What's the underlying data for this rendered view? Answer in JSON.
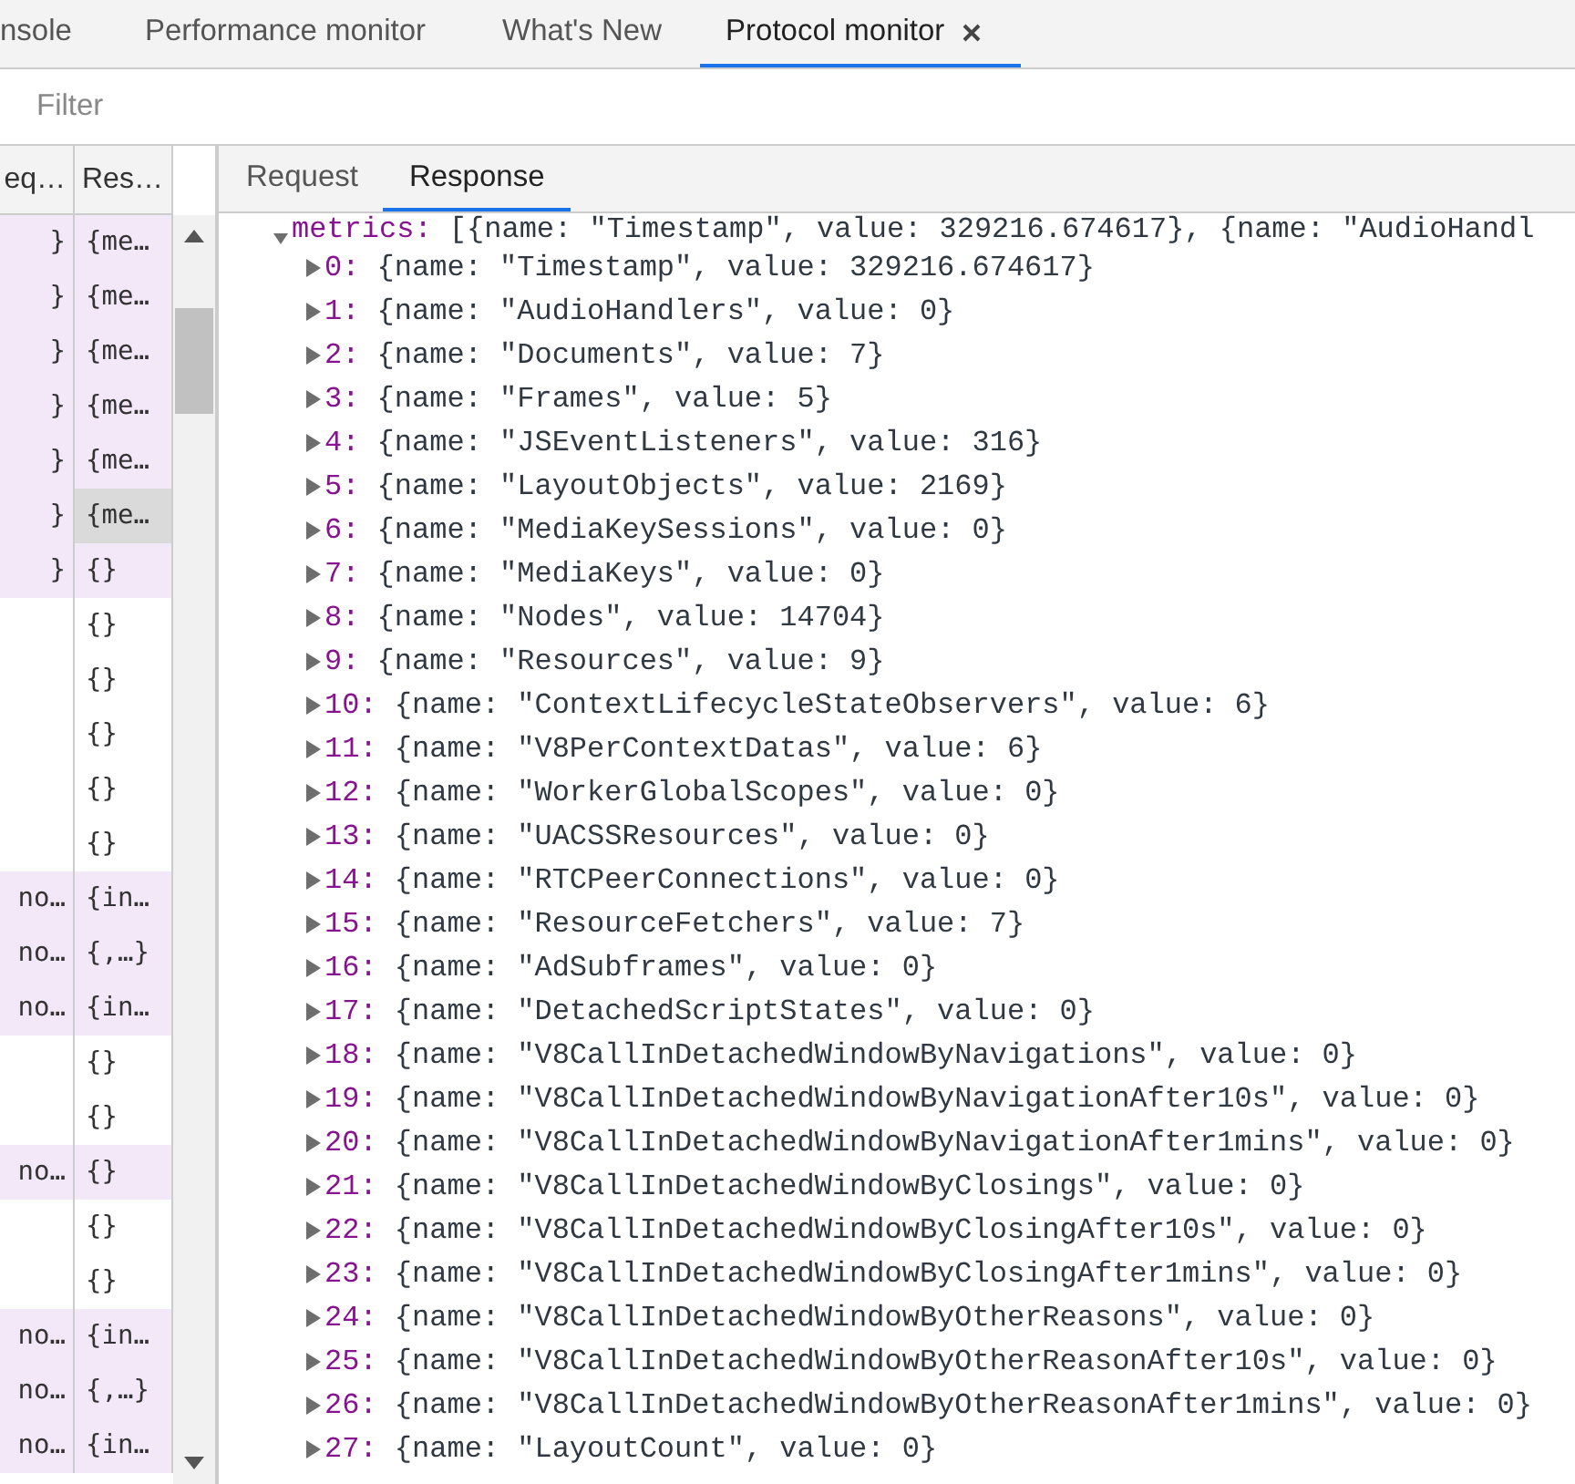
{
  "tabs": [
    {
      "label": "nsole",
      "selected": false,
      "closable": false
    },
    {
      "label": "Performance monitor",
      "selected": false,
      "closable": false
    },
    {
      "label": "What's New",
      "selected": false,
      "closable": false
    },
    {
      "label": "Protocol monitor",
      "selected": true,
      "closable": true
    }
  ],
  "filter": {
    "placeholder": "Filter"
  },
  "messages": {
    "columns": [
      "eq…",
      "Res…"
    ],
    "rows": [
      {
        "column_1": "}",
        "column_2": "{me…",
        "highlighted": true,
        "selected": false
      },
      {
        "column_1": "}",
        "column_2": "{me…",
        "highlighted": true,
        "selected": false
      },
      {
        "column_1": "}",
        "column_2": "{me…",
        "highlighted": true,
        "selected": false
      },
      {
        "column_1": "}",
        "column_2": "{me…",
        "highlighted": true,
        "selected": false
      },
      {
        "column_1": "}",
        "column_2": "{me…",
        "highlighted": true,
        "selected": false
      },
      {
        "column_1": "}",
        "column_2": "{me…",
        "highlighted": true,
        "selected": true
      },
      {
        "column_1": "}",
        "column_2": "{}",
        "highlighted": true,
        "selected": false
      },
      {
        "column_2": "{}",
        "highlighted": false,
        "selected": false
      },
      {
        "column_2": "{}",
        "highlighted": false,
        "selected": false
      },
      {
        "column_2": "{}",
        "highlighted": false,
        "selected": false
      },
      {
        "column_2": "{}",
        "highlighted": false,
        "selected": false
      },
      {
        "column_2": "{}",
        "highlighted": false,
        "selected": false
      },
      {
        "column_1": "no…",
        "column_2": "{in…",
        "highlighted": true,
        "selected": false
      },
      {
        "column_1": "no…",
        "column_2": "{,…}",
        "highlighted": true,
        "selected": false
      },
      {
        "column_1": "no…",
        "column_2": "{in…",
        "highlighted": true,
        "selected": false
      },
      {
        "column_2": "{}",
        "highlighted": false,
        "selected": false
      },
      {
        "column_2": "{}",
        "highlighted": false,
        "selected": false
      },
      {
        "column_1": "no…",
        "column_2": "{}",
        "highlighted": true,
        "selected": false
      },
      {
        "column_2": "{}",
        "highlighted": false,
        "selected": false
      },
      {
        "column_2": "{}",
        "highlighted": false,
        "selected": false
      },
      {
        "column_1": "no…",
        "column_2": "{in…",
        "highlighted": true,
        "selected": false
      },
      {
        "column_1": "no…",
        "column_2": "{,…}",
        "highlighted": true,
        "selected": false
      },
      {
        "column_1": "no…",
        "column_2": "{in…",
        "highlighted": true,
        "selected": false
      }
    ]
  },
  "detail": {
    "tabs": [
      {
        "label": "Request",
        "selected": false
      },
      {
        "label": "Response",
        "selected": true
      }
    ],
    "tree": {
      "key": "metrics:",
      "value": "[{name: \"Timestamp\", value: 329216.674617}, {name: \"AudioHandl",
      "expanded": true,
      "children": [
        {
          "key": "0:",
          "value": "{name: \"Timestamp\", value: 329216.674617}",
          "expanded": false
        },
        {
          "key": "1:",
          "value": "{name: \"AudioHandlers\", value: 0}",
          "expanded": false
        },
        {
          "key": "2:",
          "value": "{name: \"Documents\", value: 7}",
          "expanded": false
        },
        {
          "key": "3:",
          "value": "{name: \"Frames\", value: 5}",
          "expanded": false
        },
        {
          "key": "4:",
          "value": "{name: \"JSEventListeners\", value: 316}",
          "expanded": false
        },
        {
          "key": "5:",
          "value": "{name: \"LayoutObjects\", value: 2169}",
          "expanded": false
        },
        {
          "key": "6:",
          "value": "{name: \"MediaKeySessions\", value: 0}",
          "expanded": false
        },
        {
          "key": "7:",
          "value": "{name: \"MediaKeys\", value: 0}",
          "expanded": false
        },
        {
          "key": "8:",
          "value": "{name: \"Nodes\", value: 14704}",
          "expanded": false
        },
        {
          "key": "9:",
          "value": "{name: \"Resources\", value: 9}",
          "expanded": false
        },
        {
          "key": "10:",
          "value": "{name: \"ContextLifecycleStateObservers\", value: 6}",
          "expanded": false
        },
        {
          "key": "11:",
          "value": "{name: \"V8PerContextDatas\", value: 6}",
          "expanded": false
        },
        {
          "key": "12:",
          "value": "{name: \"WorkerGlobalScopes\", value: 0}",
          "expanded": false
        },
        {
          "key": "13:",
          "value": "{name: \"UACSSResources\", value: 0}",
          "expanded": false
        },
        {
          "key": "14:",
          "value": "{name: \"RTCPeerConnections\", value: 0}",
          "expanded": false
        },
        {
          "key": "15:",
          "value": "{name: \"ResourceFetchers\", value: 7}",
          "expanded": false
        },
        {
          "key": "16:",
          "value": "{name: \"AdSubframes\", value: 0}",
          "expanded": false
        },
        {
          "key": "17:",
          "value": "{name: \"DetachedScriptStates\", value: 0}",
          "expanded": false
        },
        {
          "key": "18:",
          "value": "{name: \"V8CallInDetachedWindowByNavigations\", value: 0}",
          "expanded": false
        },
        {
          "key": "19:",
          "value": "{name: \"V8CallInDetachedWindowByNavigationAfter10s\", value: 0}",
          "expanded": false
        },
        {
          "key": "20:",
          "value": "{name: \"V8CallInDetachedWindowByNavigationAfter1mins\", value: 0}",
          "expanded": false
        },
        {
          "key": "21:",
          "value": "{name: \"V8CallInDetachedWindowByClosings\", value: 0}",
          "expanded": false
        },
        {
          "key": "22:",
          "value": "{name: \"V8CallInDetachedWindowByClosingAfter10s\", value: 0}",
          "expanded": false
        },
        {
          "key": "23:",
          "value": "{name: \"V8CallInDetachedWindowByClosingAfter1mins\", value: 0}",
          "expanded": false
        },
        {
          "key": "24:",
          "value": "{name: \"V8CallInDetachedWindowByOtherReasons\", value: 0}",
          "expanded": false
        },
        {
          "key": "25:",
          "value": "{name: \"V8CallInDetachedWindowByOtherReasonAfter10s\", value: 0}",
          "expanded": false
        },
        {
          "key": "26:",
          "value": "{name: \"V8CallInDetachedWindowByOtherReasonAfter1mins\", value: 0}",
          "expanded": false
        },
        {
          "key": "27:",
          "value": "{name: \"LayoutCount\", value: 0}",
          "expanded": false
        }
      ]
    }
  }
}
